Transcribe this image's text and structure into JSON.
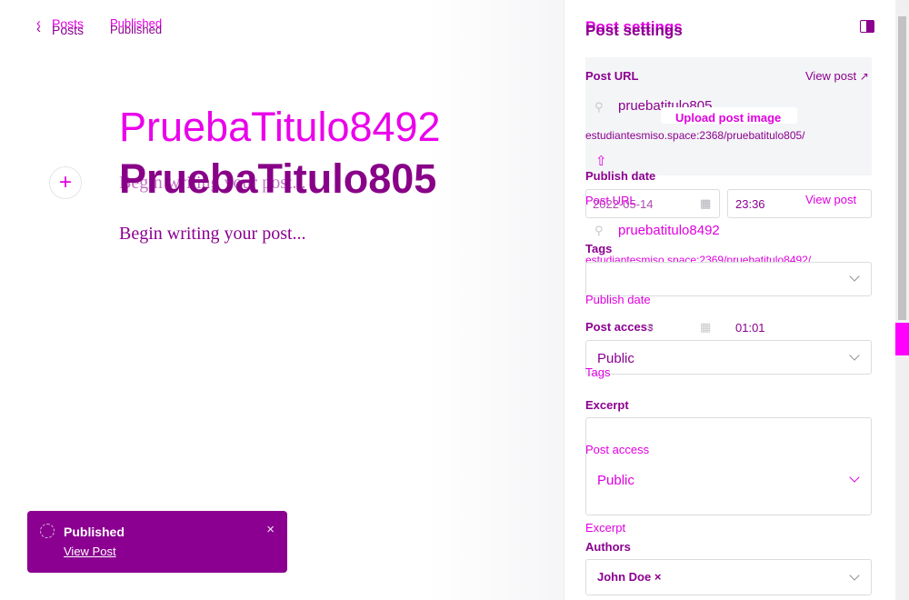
{
  "header": {
    "back_label": "Posts",
    "status": "Published"
  },
  "editor": {
    "title_primary": "PruebaTitulo8492",
    "title_secondary": "PruebaTitulo805",
    "body_placeholder": "Begin writing your post...",
    "add_card_glyph": "+"
  },
  "toast": {
    "title": "Published",
    "link": "View Post",
    "close": "×"
  },
  "settings": {
    "title": "Post settings",
    "post_url_label": "Post URL",
    "view_post": "View post",
    "slug_a": "pruebatitulo805",
    "full_url_a": "estudiantesmiso.space:2368/pruebatitulo805/",
    "upload_image": "Upload post image",
    "slug_b": "pruebatitulo8492",
    "full_url_b": "estudiantesmiso.space:2369/pruebatitulo8492/",
    "publish_date_label": "Publish date",
    "date_a": "2022-05-14",
    "time_a": "23:36",
    "time_b": "01:01",
    "date_b_fragment": "5",
    "tags_label": "Tags",
    "post_access_label": "Post access",
    "access_value": "Public",
    "excerpt_label": "Excerpt",
    "authors_label": "Authors",
    "author": "John Doe",
    "author_remove": "×"
  },
  "colors": {
    "accent_magenta": "#e000e0",
    "accent_purple": "#8b0090",
    "toast_bg": "#8b0090"
  }
}
